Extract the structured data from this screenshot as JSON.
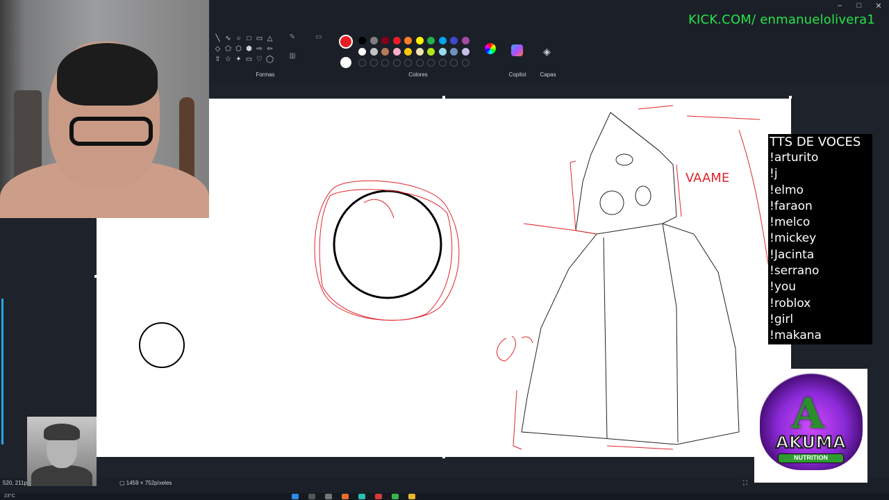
{
  "ribbon": {
    "groups": {
      "shapes_label": "Formas",
      "colors_label": "Colores",
      "copilot_label": "Copilot",
      "layers_label": "Capas"
    },
    "shape_icons": [
      "╲",
      "∿",
      "○",
      "□",
      "▭",
      "△",
      "◇",
      "⬠",
      "⬡",
      "⬢",
      "⇨",
      "⇦",
      "⇧",
      "☆",
      "✦",
      "▭",
      "♡",
      "◯"
    ],
    "tool_icons": [
      "pen-icon",
      "fill-icon",
      "resize-icon"
    ],
    "primary_color": "#e81c24",
    "secondary_color": "#ffffff",
    "palette_row1": [
      "#000000",
      "#7f7f7f",
      "#880015",
      "#ed1c24",
      "#ff7f27",
      "#fff200",
      "#22b14c",
      "#00a2e8",
      "#3f48cc",
      "#a349a4"
    ],
    "palette_row2": [
      "#ffffff",
      "#c3c3c3",
      "#b97a57",
      "#ffaec9",
      "#ffc90e",
      "#efe4b0",
      "#b5e61d",
      "#99d9ea",
      "#7092be",
      "#c8bfe7"
    ],
    "palette_row3_empty": 10,
    "kick_text": "KICK.COM/ enmanuelolivera1",
    "window_controls": [
      "–",
      "□",
      "✕"
    ]
  },
  "status": {
    "coords": "520, 211píxeles",
    "canvas_size": "1459 × 752píxeles",
    "fit_icon": "fit-screen-icon",
    "weather": "23°C"
  },
  "tts": {
    "title": "TTS DE VOCES",
    "commands": [
      "!arturito",
      "!j",
      "!elmo",
      "!faraon",
      "!melco",
      "!mickey",
      "!Jacinta",
      "!serrano",
      "!you",
      "!roblox",
      "!girl",
      "!makana"
    ]
  },
  "sponsor": {
    "name": "AKUMA",
    "sub": "NUTRITION"
  },
  "drawing": {
    "scrawl_text": "VAAME"
  },
  "colors": {
    "ribbon_bg": "#1b2028",
    "workspace_bg": "#1e232b",
    "kick_green": "#27e34a",
    "ink_red": "#e0242b"
  }
}
